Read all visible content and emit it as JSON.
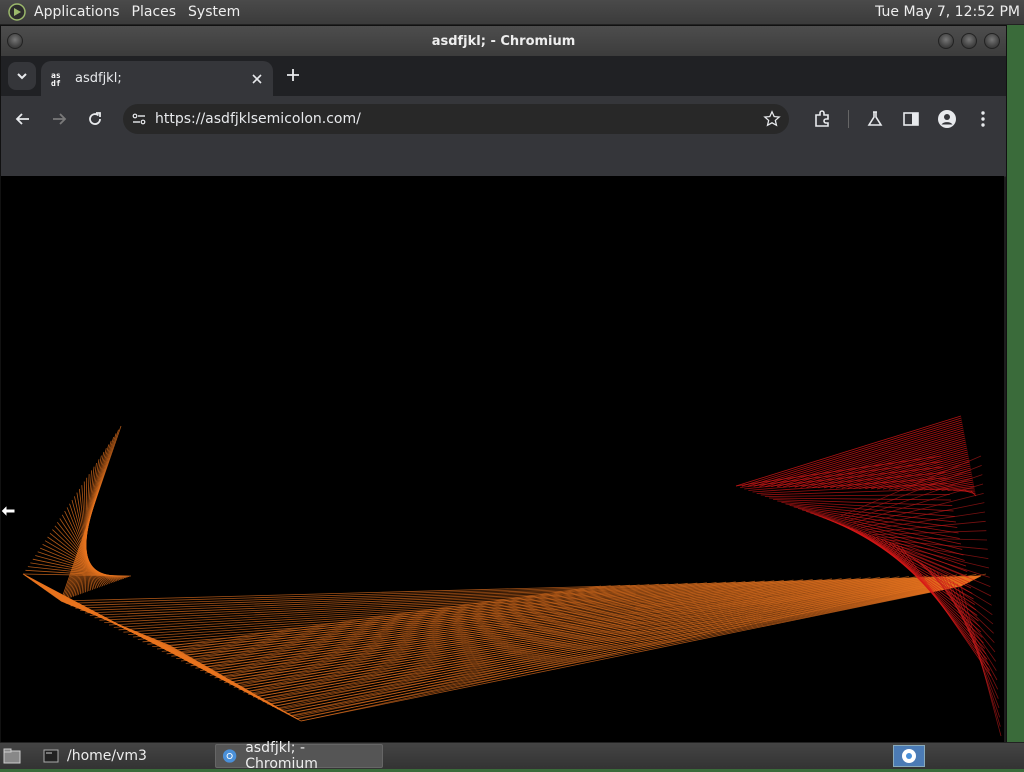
{
  "top_panel": {
    "menus": [
      "Applications",
      "Places",
      "System"
    ],
    "clock": "Tue May  7, 12:52 PM"
  },
  "window": {
    "title": "asdfjkl; - Chromium"
  },
  "browser": {
    "tab": {
      "title": "asdfjkl;",
      "favicon_text": "as df"
    },
    "url": "https://asdfjklsemicolon.com/"
  },
  "taskbar": {
    "tasks": [
      {
        "label": "/home/vm3",
        "icon": "terminal-icon"
      },
      {
        "label": "asdfjkl; - Chromium",
        "icon": "chromium-icon"
      }
    ]
  },
  "colors": {
    "accent_orange": "#e8741f",
    "accent_red": "#d81818",
    "page_bg": "#000000"
  }
}
